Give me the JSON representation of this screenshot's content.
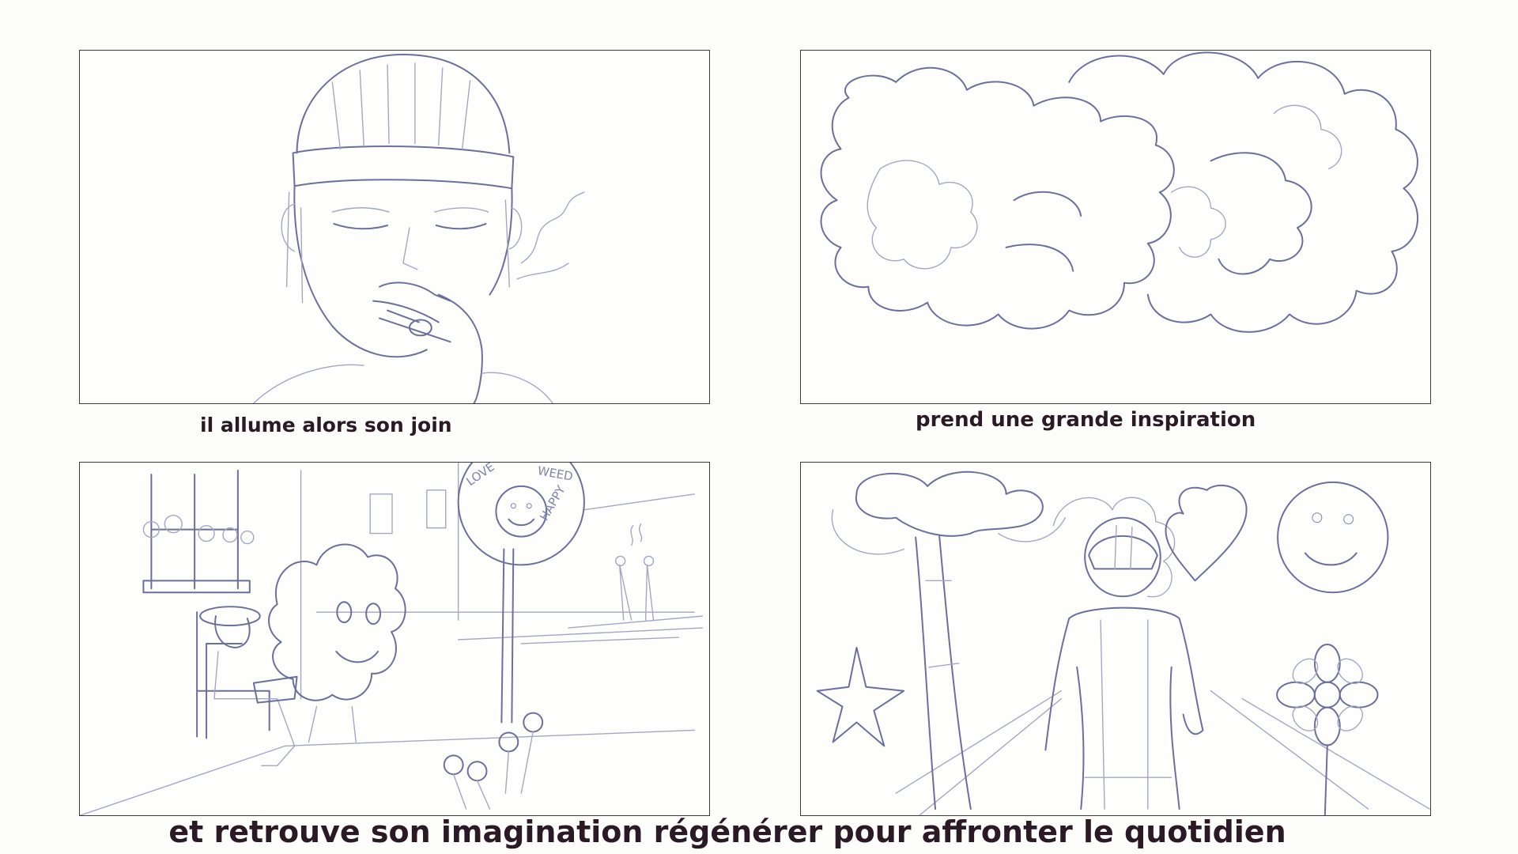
{
  "storyboard": {
    "panels": [
      {
        "caption": "il allume alors son join",
        "illustration": "man-smoking-sketch"
      },
      {
        "caption": "prend une grande inspiration",
        "illustration": "smoke-cloud-sketch"
      },
      {
        "illustration": "street-scene-sketch",
        "sign_words": [
          "LOVE",
          "WEED",
          "HAPPY"
        ]
      },
      {
        "illustration": "dream-scene-sketch"
      }
    ],
    "bottom_caption": "et retrouve son imagination régénérer pour affronter le quotidien"
  },
  "colors": {
    "background": "#fdfdfb",
    "panel_border": "#3b3b3b",
    "sketch_stroke": "#6b6f9c",
    "caption_text": "#2a1a26"
  }
}
